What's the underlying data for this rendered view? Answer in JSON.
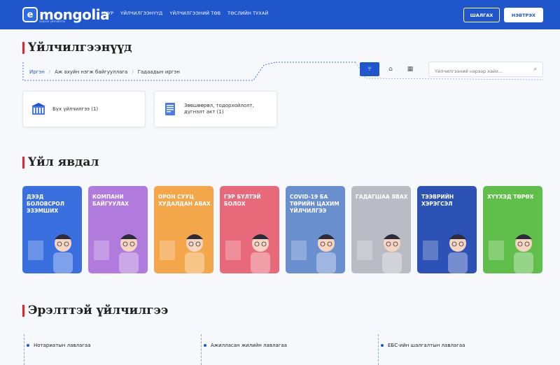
{
  "header": {
    "logo_letter": "e",
    "logo_text": "mongolia",
    "logo_sub": "хэрхэн үйлчилгээ",
    "nav": [
      "НҮҮР",
      "ҮЙЛЧИЛГЭЭНҮҮД",
      "ҮЙЛЧИЛГЭЭНИЙ ТӨВ",
      "ТӨСЛИЙН ТУХАЙ"
    ],
    "check_label": "ШАЛГАХ",
    "login_label": "НЭВТРЭХ"
  },
  "services": {
    "title": "Үйлчилгээнүүд",
    "breadcrumb": [
      "Иргэн",
      "Аж ахуйн нэгж байгууллага",
      "Гадаадын иргэн"
    ],
    "search_placeholder": "Үйлчилгээний нэрээр хайх...",
    "view_icons": [
      "filter-icon",
      "building-icon",
      "grid-icon"
    ],
    "categories": [
      {
        "label": "Бүх үйлчилгээ (1)",
        "icon": "institution-icon"
      },
      {
        "label": "Зөвшөөрөл, тодорхойлолт, дүгнэлт акт (1)",
        "icon": "document-icon"
      }
    ]
  },
  "life_events": {
    "title": "Үйл явдал",
    "tiles": [
      {
        "label": "ДЭЭД БОЛОВСРОЛ ЭЗЭМШИХ",
        "color": "#3a6fe0"
      },
      {
        "label": "КОМПАНИ БАЙГУУЛАХ",
        "color": "#b07bdc"
      },
      {
        "label": "ОРОН СУУЦ ХУДАЛДАН АВАХ",
        "color": "#f4a64a"
      },
      {
        "label": "ГЭР БҮЛТЭЙ БОЛОХ",
        "color": "#e86a7a"
      },
      {
        "label": "COVID-19 БА ТӨРИЙН ЦАХИМ ҮЙЛЧИЛГЭЭ",
        "color": "#6a8fcf"
      },
      {
        "label": "ГАДАГШАА ЯВАХ",
        "color": "#b9bcc4"
      },
      {
        "label": "ТЭЭВРИЙН ХЭРЭГСЭЛ",
        "color": "#2d52b5"
      },
      {
        "label": "ХҮҮХЭД ТӨРӨХ",
        "color": "#5fbf4a"
      }
    ]
  },
  "related": {
    "title": "Эрэлттэй үйлчилгээ",
    "items": [
      "Нотариатын лавлагаа",
      "Ажилласан жилийн лавлагаа",
      "ЕБС-ийн шалгалтын лавлагаа"
    ]
  }
}
